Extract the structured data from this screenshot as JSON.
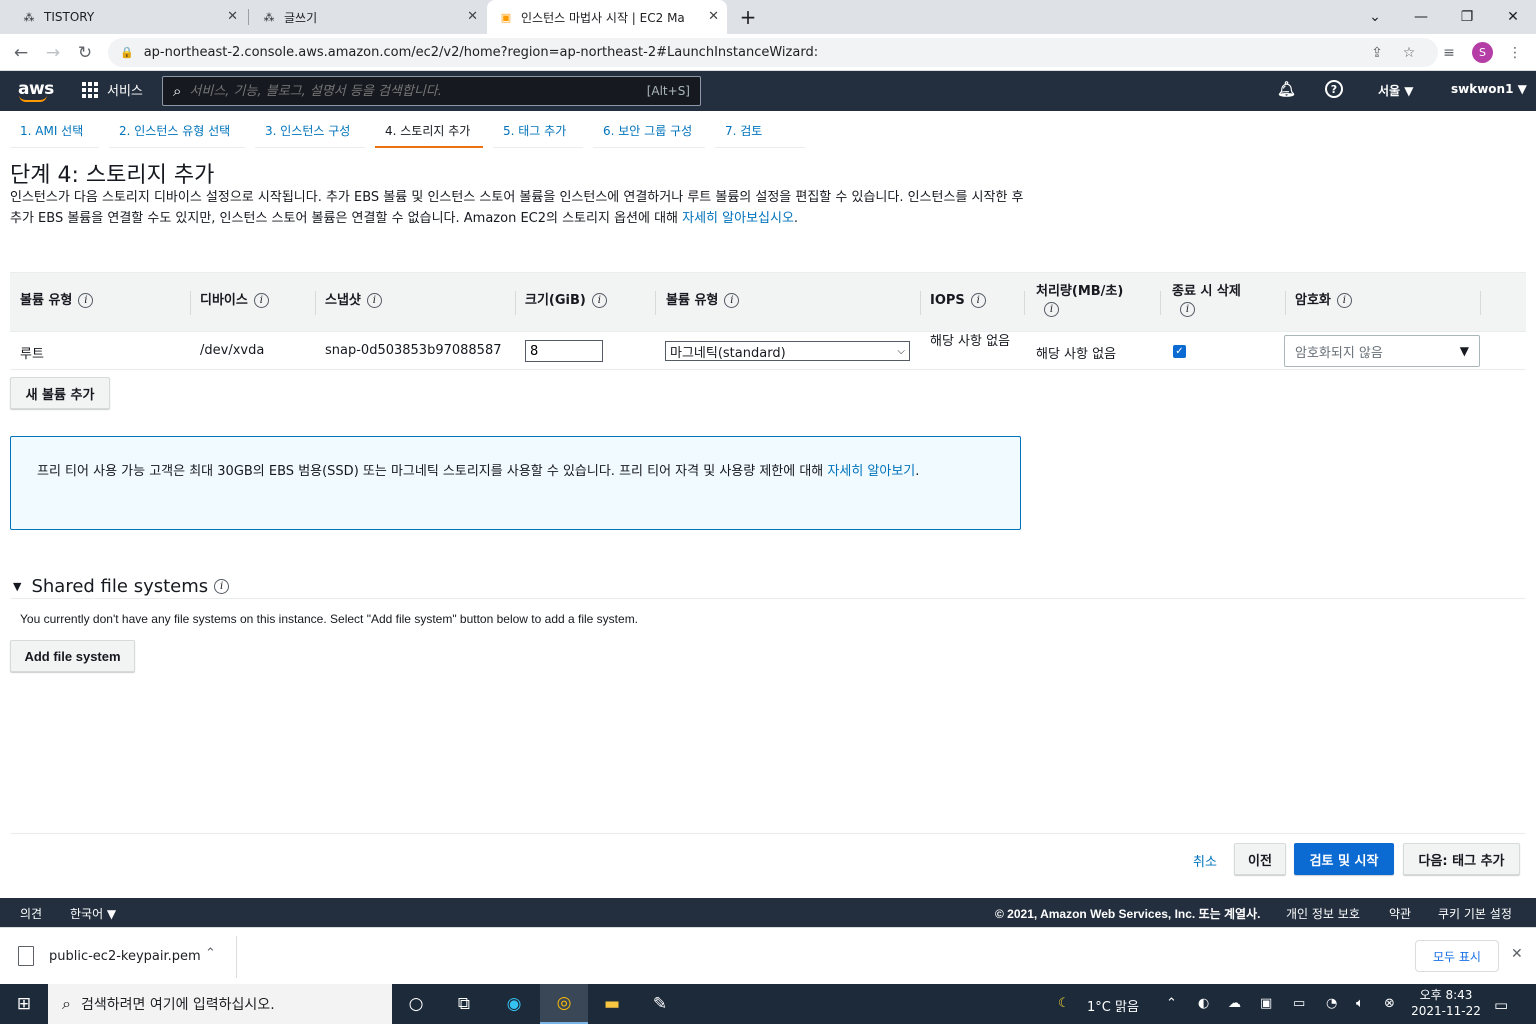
{
  "browser": {
    "tabs": [
      {
        "title": "TISTORY",
        "icon": "tistory-icon"
      },
      {
        "title": "글쓰기",
        "icon": "tistory-icon"
      },
      {
        "title": "인스턴스 마법사 시작 | EC2 Ma",
        "icon": "aws-cube-icon"
      }
    ],
    "url": "ap-northeast-2.console.aws.amazon.com/ec2/v2/home?region=ap-northeast-2#LaunchInstanceWizard:",
    "profile_initial": "S"
  },
  "aws_nav": {
    "logo": "aws",
    "services_label": "서비스",
    "search_placeholder": "서비스, 기능, 블로그, 설명서 등을 검색합니다.",
    "search_shortcut": "[Alt+S]",
    "region": "서울 ▼",
    "user": "swkwon1 ▼"
  },
  "wizard_steps": [
    {
      "label": "1. AMI 선택",
      "active": false
    },
    {
      "label": "2. 인스턴스 유형 선택",
      "active": false
    },
    {
      "label": "3. 인스턴스 구성",
      "active": false
    },
    {
      "label": "4. 스토리지 추가",
      "active": true
    },
    {
      "label": "5. 태그 추가",
      "active": false
    },
    {
      "label": "6. 보안 그룹 구성",
      "active": false
    },
    {
      "label": "7. 검토",
      "active": false
    }
  ],
  "page": {
    "title": "단계 4: 스토리지 추가",
    "description": "인스턴스가 다음 스토리지 디바이스 설정으로 시작됩니다. 추가 EBS 볼륨 및 인스턴스 스토어 볼륨을 인스턴스에 연결하거나 루트 볼륨의 설정을 편집할 수 있습니다. 인스턴스를 시작한 후 추가 EBS 볼륨을 연결할 수도 있지만, 인스턴스 스토어 볼륨은 연결할 수 없습니다. Amazon EC2의 스토리지 옵션에 대해 ",
    "description_link": "자세히 알아보십시오",
    "description_end": "."
  },
  "storage_table": {
    "headers": [
      "볼륨 유형",
      "디바이스",
      "스냅샷",
      "크기(GiB)",
      "볼륨 유형",
      "IOPS",
      "처리량(MB/초)",
      "종료 시 삭제",
      "암호화"
    ],
    "row": {
      "volume_kind": "루트",
      "device": "/dev/xvda",
      "snapshot": "snap-0d503853b97088587",
      "size": "8",
      "volume_type": "마그네틱(standard)",
      "iops": "해당 사항 없음",
      "throughput": "해당 사항 없음",
      "delete_on_termination": true,
      "encryption": "암호화되지 않음"
    }
  },
  "add_volume_label": "새 볼륨 추가",
  "free_tier": {
    "text": "프리 티어 사용 가능 고객은 최대 30GB의 EBS 범용(SSD) 또는 마그네틱 스토리지를 사용할 수 있습니다. 프리 티어 자격 및 사용량 제한에 대해 ",
    "link": "자세히 알아보기",
    "end": "."
  },
  "shared_fs": {
    "title": "Shared file systems",
    "description": "You currently don't have any file systems on this instance. Select \"Add file system\" button below to add a file system.",
    "add_label": "Add file system"
  },
  "actions": {
    "cancel": "취소",
    "previous": "이전",
    "review_launch": "검토 및 시작",
    "next": "다음: 태그 추가"
  },
  "footer": {
    "feedback": "의견",
    "language": "한국어 ▼",
    "copyright": "© 2021, Amazon Web Services, Inc. 또는 계열사.",
    "privacy": "개인 정보 보호",
    "terms": "약관",
    "cookies": "쿠키 기본 설정"
  },
  "download_bar": {
    "filename": "public-ec2-keypair.pem",
    "show_all": "모두 표시"
  },
  "taskbar": {
    "search_placeholder": "검색하려면 여기에 입력하십시오.",
    "weather": "1°C  맑음",
    "time": "오후 8:43",
    "date": "2021-11-22"
  },
  "colors": {
    "aws_nav": "#232f3e",
    "aws_orange": "#ec7211",
    "link": "#0073bb",
    "primary_button": "#0b6bd3"
  }
}
